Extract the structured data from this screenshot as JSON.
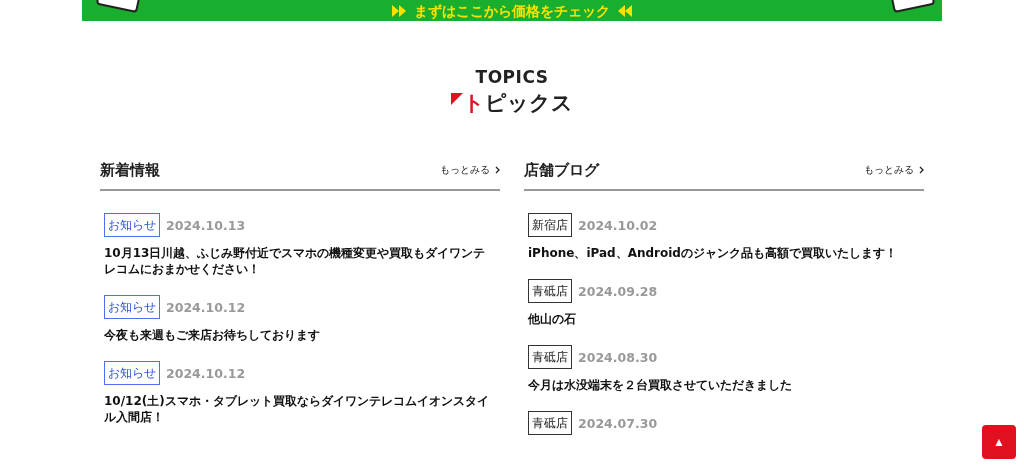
{
  "banner": {
    "text": "まずはここから価格をチェック"
  },
  "section": {
    "title_en": "TOPICS",
    "title_ja": "トピックス"
  },
  "columns": [
    {
      "title": "新着情報",
      "more": "もっとみる",
      "items": [
        {
          "kind": "notice",
          "tag": "お知らせ",
          "date": "2024.10.13",
          "title": "10月13日川越、ふじみ野付近でスマホの機種変更や買取もダイワンテレコムにおまかせください！"
        },
        {
          "kind": "notice",
          "tag": "お知らせ",
          "date": "2024.10.12",
          "title": "今夜も来週もご来店お待ちしております"
        },
        {
          "kind": "notice",
          "tag": "お知らせ",
          "date": "2024.10.12",
          "title": "10/12(土)スマホ・タブレット買取ならダイワンテレコムイオンスタイル入間店！"
        }
      ]
    },
    {
      "title": "店舗ブログ",
      "more": "もっとみる",
      "items": [
        {
          "kind": "shop",
          "tag": "新宿店",
          "date": "2024.10.02",
          "title": "iPhone、iPad、Androidのジャンク品も高額で買取いたします！"
        },
        {
          "kind": "shop",
          "tag": "青砥店",
          "date": "2024.09.28",
          "title": "他山の石"
        },
        {
          "kind": "shop",
          "tag": "青砥店",
          "date": "2024.08.30",
          "title": "今月は水没端末を２台買取させていただきました"
        },
        {
          "kind": "shop",
          "tag": "青砥店",
          "date": "2024.07.30"
        }
      ]
    }
  ],
  "back_to_top": {
    "label": "▲"
  }
}
